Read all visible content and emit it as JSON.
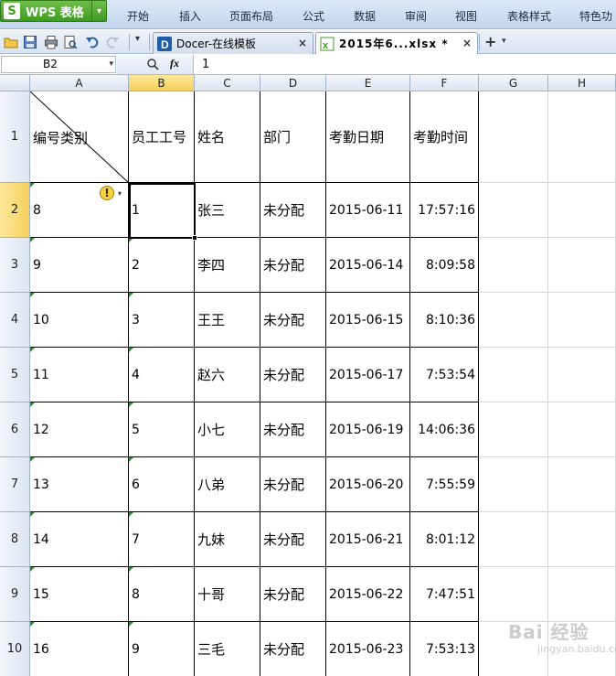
{
  "app": {
    "name": "WPS 表格",
    "logo_glyph": "S",
    "accent": "#3f9a22"
  },
  "ribbon_tabs": [
    "开始",
    "插入",
    "页面布局",
    "公式",
    "数据",
    "审阅",
    "视图",
    "表格样式",
    "特色功"
  ],
  "document_tabs": [
    {
      "label": "Docer-在线模板",
      "icon": "docer-icon",
      "active": false
    },
    {
      "label": "2015年6...xlsx *",
      "icon": "excel-file-icon",
      "active": true
    }
  ],
  "formula_bar": {
    "name_box": "B2",
    "fx_label": "fx",
    "formula": "1"
  },
  "columns": [
    "A",
    "B",
    "C",
    "D",
    "E",
    "F",
    "G",
    "H"
  ],
  "selected_column": "B",
  "selected_row": "2",
  "header_row": {
    "row_num": "1",
    "cells": [
      "编号类别",
      "员工工号",
      "姓名",
      "部门",
      "考勤日期",
      "考勤时间"
    ]
  },
  "rows": [
    {
      "row_num": "2",
      "cells": [
        "8",
        "1",
        "张三",
        "未分配",
        "2015-06-11",
        "17:57:16"
      ]
    },
    {
      "row_num": "3",
      "cells": [
        "9",
        "2",
        "李四",
        "未分配",
        "2015-06-14",
        "8:09:58"
      ]
    },
    {
      "row_num": "4",
      "cells": [
        "10",
        "3",
        "王王",
        "未分配",
        "2015-06-15",
        "8:10:36"
      ]
    },
    {
      "row_num": "5",
      "cells": [
        "11",
        "4",
        "赵六",
        "未分配",
        "2015-06-17",
        "7:53:54"
      ]
    },
    {
      "row_num": "6",
      "cells": [
        "12",
        "5",
        "小七",
        "未分配",
        "2015-06-19",
        "14:06:36"
      ]
    },
    {
      "row_num": "7",
      "cells": [
        "13",
        "6",
        "八弟",
        "未分配",
        "2015-06-20",
        "7:55:59"
      ]
    },
    {
      "row_num": "8",
      "cells": [
        "14",
        "7",
        "九妹",
        "未分配",
        "2015-06-21",
        "8:01:12"
      ]
    },
    {
      "row_num": "9",
      "cells": [
        "15",
        "8",
        "十哥",
        "未分配",
        "2015-06-22",
        "7:47:51"
      ]
    },
    {
      "row_num": "10",
      "cells": [
        "16",
        "9",
        "三毛",
        "未分配",
        "2015-06-23",
        "7:53:13"
      ]
    }
  ],
  "error_indicator": "!",
  "watermark": {
    "main": "Bai 经验",
    "sub": "jingyan.baidu.com"
  }
}
